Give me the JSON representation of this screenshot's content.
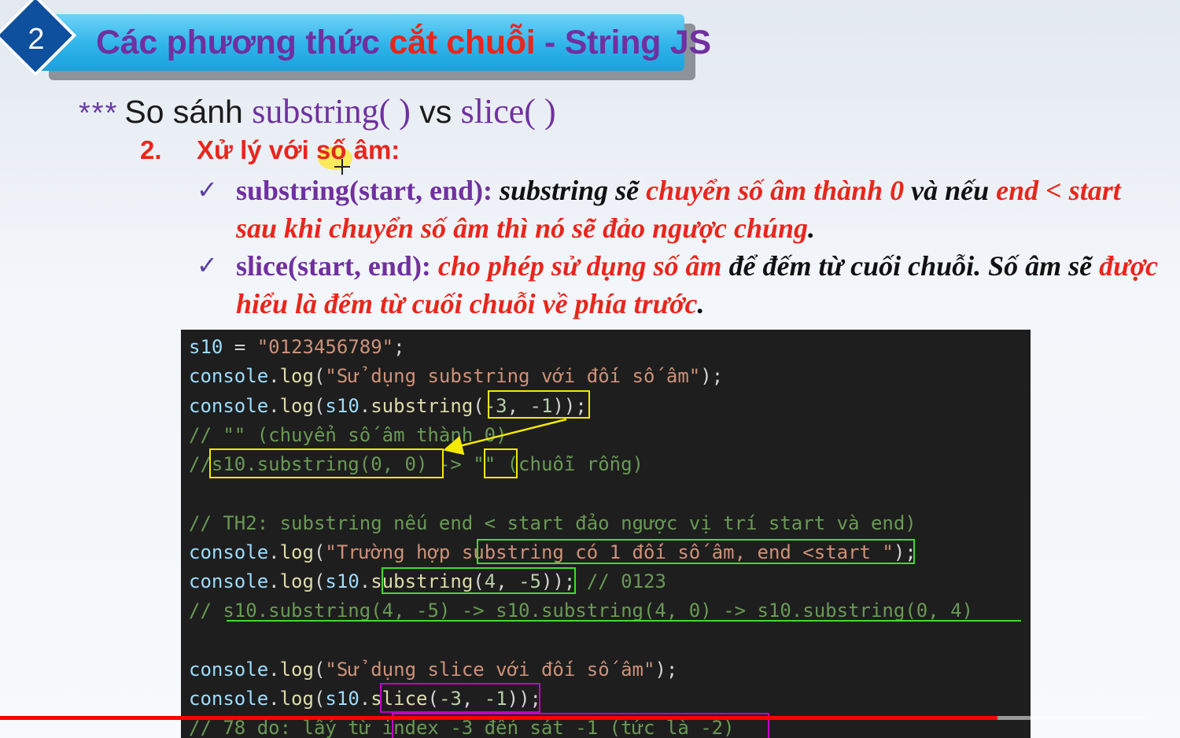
{
  "banner": {
    "number": "2",
    "title_part1": "Các phương thức ",
    "title_highlight": "cắt chuỗi",
    "title_part2": " - String JS"
  },
  "heading": {
    "stars": "***",
    "prefix": "So sánh ",
    "fn1": "substring( )",
    "vs": " vs ",
    "fn2": "slice( )"
  },
  "subheading": {
    "number": "2.",
    "text": "Xử lý với số âm:"
  },
  "bullets": [
    {
      "check": "✓",
      "fn": "substring(start, end):",
      "t1": " substring sẽ ",
      "r1": "chuyển số âm thành 0",
      "t2": " và nếu ",
      "r2": "end < start sau khi chuyển số âm thì nó sẽ đảo ngược chúng",
      "t3": "."
    },
    {
      "check": "✓",
      "fn": "slice(start, end):",
      "r1": " cho phép sử dụng số âm",
      "t1": " để đếm từ cuối chuỗi. Số âm sẽ ",
      "r2": "được hiểu là đếm từ cuối chuỗi về phía trước",
      "t2": "."
    }
  ],
  "code": {
    "l1": {
      "a": "s10",
      "b": " = ",
      "c": "\"0123456789\"",
      "d": ";"
    },
    "l2": {
      "a": "console",
      "b": ".",
      "c": "log",
      "d": "(",
      "e": "\"Sử dụng substring với đối số âm\"",
      "f": ");"
    },
    "l3": {
      "a": "console",
      "b": ".",
      "c": "log",
      "d": "(",
      "e": "s10",
      "f": ".",
      "g": "substring",
      "h": "(",
      "i": "-3",
      "j": ", ",
      "k": "-1",
      "l": "));"
    },
    "l4": "// \"\" (chuyển số âm thành 0)",
    "l5": {
      "a": "//",
      "b": "s10.substring(0, 0)",
      "c": " -> ",
      "d": "\"\"",
      "e": " (chuỗi rỗng)"
    },
    "l6": "// TH2: substring nếu end < start đảo ngược vị trí start và end)",
    "l7": {
      "a": "console",
      "b": ".",
      "c": "log",
      "d": "(",
      "e": "\"Trường hợp substring có 1 đối số âm, end <start \"",
      "f": ");"
    },
    "l8": {
      "a": "console",
      "b": ".",
      "c": "log",
      "d": "(",
      "e": "s10",
      "f": ".",
      "g": "substring",
      "h": "(",
      "i": "4",
      "j": ", ",
      "k": "-5",
      "l": ")); ",
      "m": "// 0123"
    },
    "l9": {
      "a": "// ",
      "b": "s10.substring(4, -5) -> s10.substring(4, 0) -> s10.substring(0, 4)"
    },
    "l10": {
      "a": "console",
      "b": ".",
      "c": "log",
      "d": "(",
      "e": "\"Sử dụng slice với đối số âm\"",
      "f": ");"
    },
    "l11": {
      "a": "console",
      "b": ".",
      "c": "log",
      "d": "(",
      "e": "s10",
      "f": ".",
      "g": "slice",
      "h": "(",
      "i": "-3",
      "j": ", ",
      "k": "-1",
      "l": "));"
    },
    "l12": "// 78 do: lấy từ index -3 đến sát -1 (tức là -2)"
  },
  "colors": {
    "title_purple": "#7030a0",
    "title_red": "#e8261c",
    "banner_blue": "#2eb4ea",
    "box_yellow": "#f4e900",
    "box_green": "#3fdd2c",
    "box_magenta": "#c400c4",
    "progress_red": "#ff0000"
  },
  "video_progress": 0.845
}
